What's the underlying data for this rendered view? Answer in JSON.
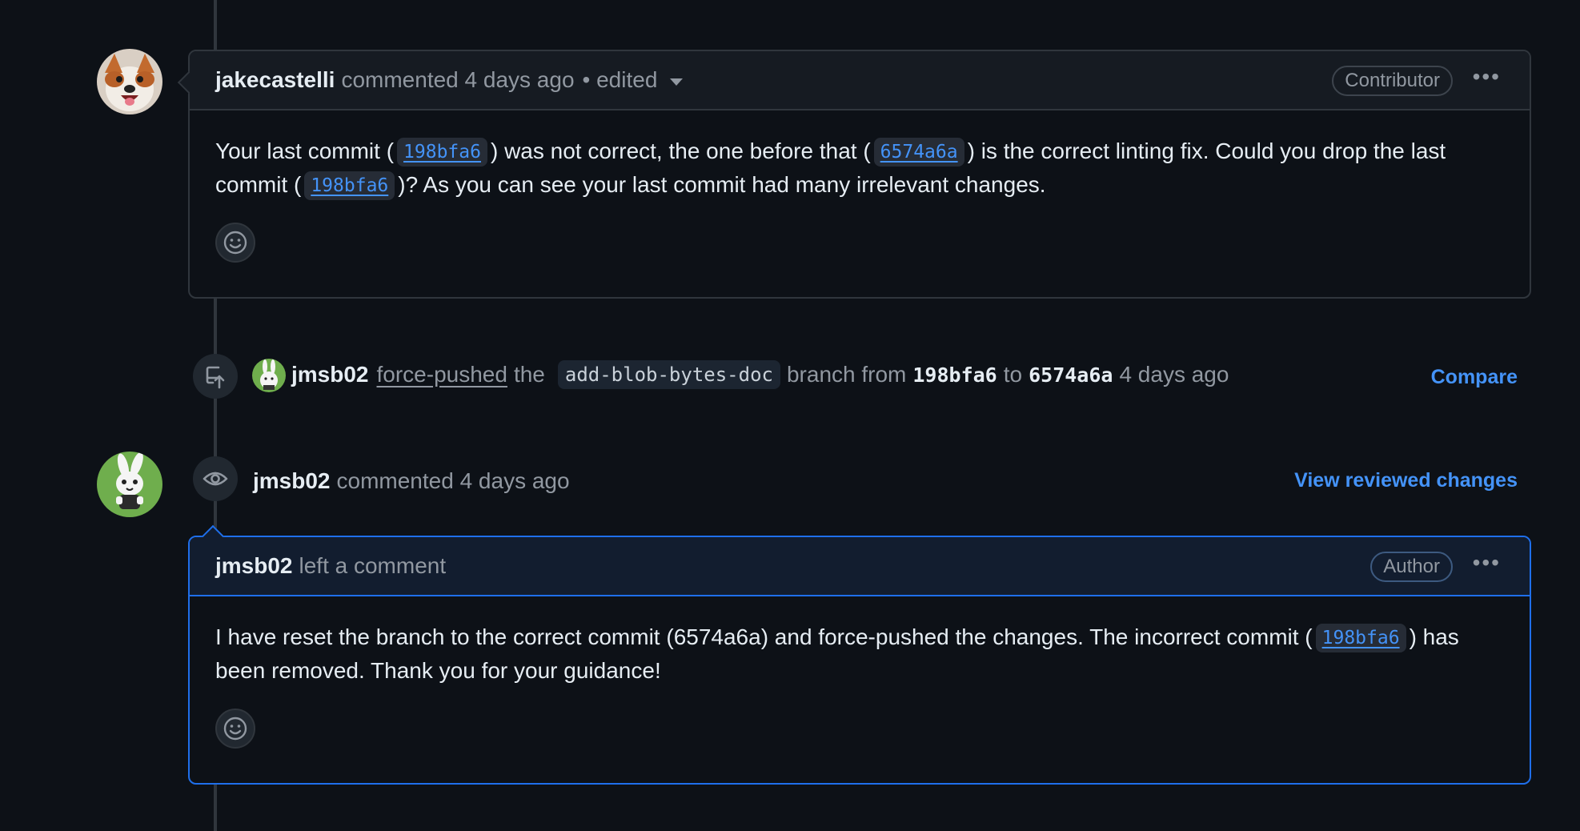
{
  "comment1": {
    "author": "jakecastelli",
    "meta": "commented 4 days ago",
    "edited": "• edited",
    "badge": "Contributor",
    "text_a": "Your last commit (",
    "sha_a": "198bfa6",
    "text_b": ") was not correct, the one before that (",
    "sha_b": "6574a6a",
    "text_c": ") is the correct linting fix. Could you drop the last commit (",
    "sha_c": "198bfa6",
    "text_d": ")? As you can see your last commit had many irrelevant changes."
  },
  "push_event": {
    "user": "jmsb02",
    "action": "force-pushed",
    "the": "the",
    "branch": "add-blob-bytes-doc",
    "from_label": "branch from",
    "from_sha": "198bfa6",
    "to_label": "to",
    "to_sha": "6574a6a",
    "time": "4 days ago",
    "compare": "Compare"
  },
  "review_event": {
    "user": "jmsb02",
    "meta": "commented 4 days ago",
    "view_link": "View reviewed changes"
  },
  "comment2": {
    "author": "jmsb02",
    "meta": "left a comment",
    "badge": "Author",
    "text_a": "I have reset the branch to the correct commit (6574a6a) and force-pushed the changes. The incorrect commit (",
    "sha_a": "198bfa6",
    "text_b": ") has been removed. Thank you for your guidance!"
  },
  "icons": [
    "dog-avatar",
    "rabbit-avatar",
    "force-push-icon",
    "eye-icon",
    "smiley-icon",
    "kebab-icon",
    "caret-down-icon"
  ],
  "colors": {
    "background": "#0d1117",
    "link": "#4493f8",
    "author_border": "#1f6feb"
  }
}
